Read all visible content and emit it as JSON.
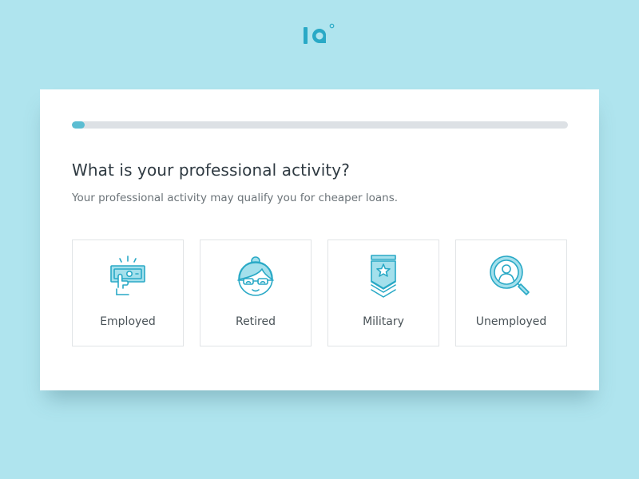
{
  "logo": {
    "text": "ia°"
  },
  "progress": {
    "value": 0.025
  },
  "question": {
    "title": "What is your professional activity?",
    "subtitle": "Your professional activity may qualify you for cheaper loans."
  },
  "options": [
    {
      "label": "Employed",
      "icon": "cash-hand-icon"
    },
    {
      "label": "Retired",
      "icon": "grandma-face-icon"
    },
    {
      "label": "Military",
      "icon": "military-rank-icon"
    },
    {
      "label": "Unemployed",
      "icon": "magnifier-person-icon"
    }
  ],
  "colors": {
    "background": "#afe4ee",
    "accent": "#29a9c6",
    "accent_light": "#a4e0ec",
    "progress_track": "#dde1e5",
    "progress_fill": "#5bbdd2"
  }
}
